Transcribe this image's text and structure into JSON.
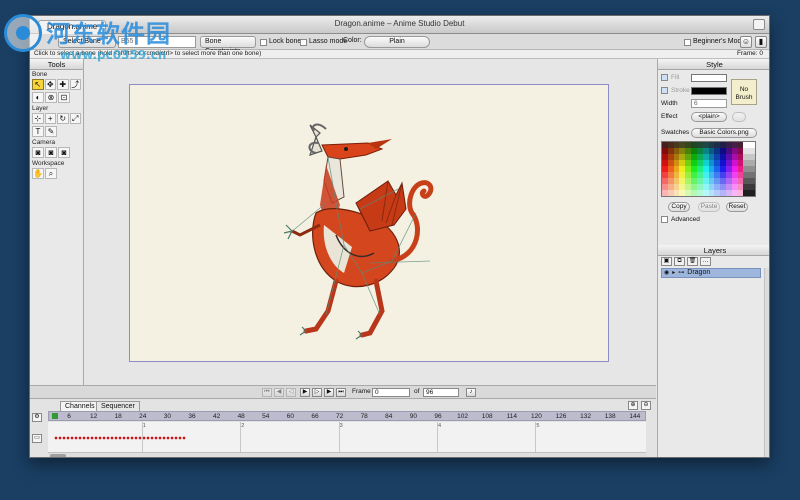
{
  "watermark": {
    "title": "河东软件园",
    "url": "www.pc0359.cn"
  },
  "window": {
    "title": "Dragon.anime – Anime Studio Debut",
    "file_tab": "Dragon.anime"
  },
  "toolbar": {
    "select_bone": "Select Bone",
    "bone_name": "B55",
    "bone_constraints": "Bone Constraints",
    "lock_bone": "Lock bone",
    "lasso_mode": "Lasso mode",
    "color_label": "Color:",
    "color_value": "Plain",
    "beginners_mode": "Beginner's Mode"
  },
  "status": {
    "hint": "Click to select a bone (hold <shift> or <cmd/ctrl> to select more than one bone)",
    "frame_readout": "Frame: 0"
  },
  "tools": {
    "header": "Tools",
    "sections": {
      "bone": "Bone",
      "layer": "Layer",
      "camera": "Camera",
      "workspace": "Workspace"
    }
  },
  "style": {
    "header": "Style",
    "fill_label": "Fill",
    "stroke_label": "Stroke",
    "width_label": "Width",
    "width_value": "6",
    "effect_label": "Effect",
    "effect_value": "<plain>",
    "no_brush": "No Brush",
    "swatches_label": "Swatches",
    "swatches_value": "Basic Colors.png",
    "copy": "Copy",
    "paste": "Paste",
    "reset": "Reset",
    "advanced": "Advanced",
    "fill_color": "#ffffff",
    "stroke_color": "#000000"
  },
  "layers": {
    "header": "Layers",
    "items": [
      {
        "name": "Dragon"
      }
    ]
  },
  "playback": {
    "frame_label": "Frame",
    "frame_value": "0",
    "of_label": "of",
    "total_frames": "96"
  },
  "timeline": {
    "tabs": [
      "Channels",
      "Sequencer"
    ],
    "ticks": [
      "6",
      "12",
      "18",
      "24",
      "30",
      "36",
      "42",
      "48",
      "54",
      "60",
      "66",
      "72",
      "78",
      "84",
      "90",
      "96",
      "102",
      "108",
      "114",
      "120",
      "126",
      "132",
      "138",
      "144"
    ],
    "markers": [
      "1",
      "2",
      "3",
      "4",
      "5"
    ]
  }
}
